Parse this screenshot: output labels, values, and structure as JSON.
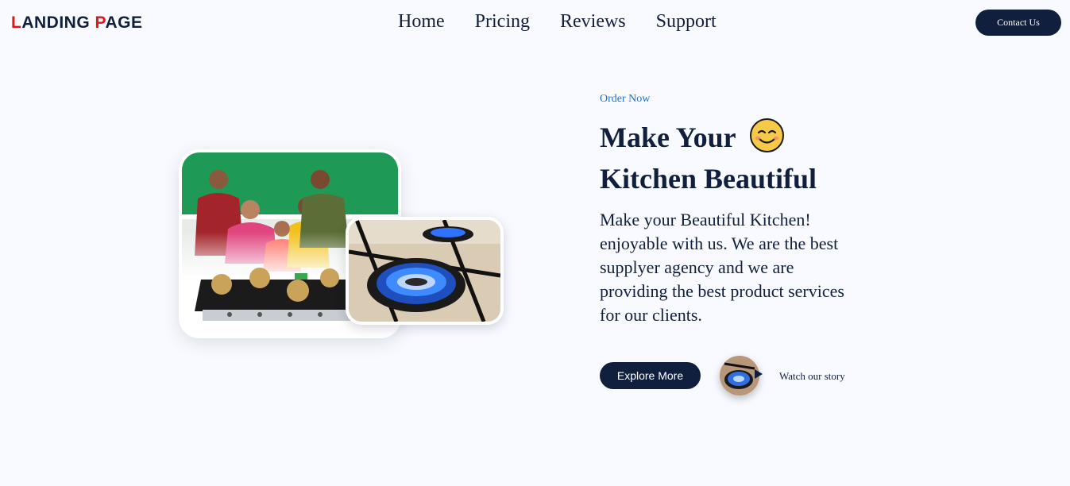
{
  "header": {
    "logo_first_l": "L",
    "logo_mid": "ANDING ",
    "logo_first_p": "P",
    "logo_end": "AGE",
    "nav": [
      "Home",
      "Pricing",
      "Reviews",
      "Support"
    ],
    "contact_label": "Contact Us"
  },
  "hero": {
    "eyebrow": "Order Now",
    "title_line1": "Make Your",
    "title_line2": "Kitchen Beautiful",
    "emoji_icon": "smiling-face-icon",
    "description": "Make your Beautiful Kitchen! enjoyable with us. We are the best supplyer agency and we are providing the best product services for our clients.",
    "explore_label": "Explore More",
    "watch_label": "Watch our story"
  },
  "colors": {
    "navy": "#0f1f3d",
    "accent_red": "#e0161b",
    "accent_blue": "#1f6fd1",
    "background": "#f9faff"
  }
}
